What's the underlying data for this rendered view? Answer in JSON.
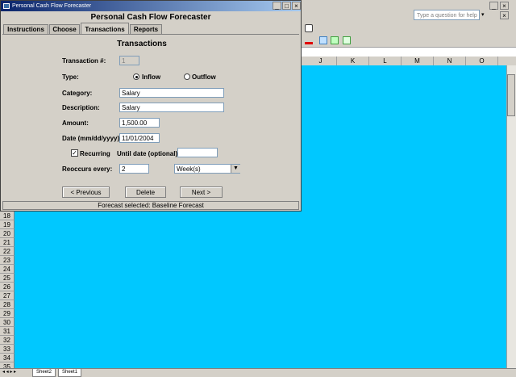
{
  "excel": {
    "help_placeholder": "Type a question for help",
    "columns": [
      "J",
      "K",
      "L",
      "M",
      "N",
      "O"
    ],
    "rows": [
      "18",
      "19",
      "20",
      "21",
      "22",
      "23",
      "24",
      "25",
      "26",
      "27",
      "28",
      "29",
      "30",
      "31",
      "32",
      "33",
      "34",
      "35"
    ],
    "sheet_tabs": [
      "Sheet2",
      "Sheet1"
    ],
    "grid_color": "#00c8ff",
    "window_buttons": {
      "minimize": "_",
      "close": "×"
    },
    "toolbar_icons": [
      "help-icon",
      "font-color-icon",
      "border-icon",
      "fill-icon"
    ],
    "nav_arrows": "◂ ◂ ▸ ▸"
  },
  "dialog": {
    "window_title": "Personal Cash Flow Forecaster",
    "heading": "Personal Cash Flow Forecaster",
    "window_buttons": {
      "minimize": "_",
      "maximize": "□",
      "close": "×"
    },
    "tabs": [
      {
        "label": "Instructions"
      },
      {
        "label": "Choose"
      },
      {
        "label": "Transactions",
        "active": true
      },
      {
        "label": "Reports"
      }
    ],
    "section_title": "Transactions",
    "form": {
      "transaction_label": "Transaction #:",
      "transaction_value": "1",
      "type_label": "Type:",
      "inflow_label": "Inflow",
      "outflow_label": "Outflow",
      "type_selected": "Inflow",
      "category_label": "Category:",
      "category_value": "Salary",
      "description_label": "Description:",
      "description_value": "Salary",
      "amount_label": "Amount:",
      "amount_value": "1,500.00",
      "date_label": "Date (mm/dd/yyyy):",
      "date_value": "11/01/2004",
      "recurring_label": "Recurring",
      "recurring_checked": true,
      "until_label": "Until date (optional):",
      "until_value": "",
      "reoccurs_label": "Reoccurs every:",
      "reoccurs_value": "2",
      "period_value": "Week(s)"
    },
    "buttons": {
      "previous": "< Previous",
      "delete": "Delete",
      "next": "Next >"
    },
    "status": "Forecast selected: Baseline Forecast"
  }
}
